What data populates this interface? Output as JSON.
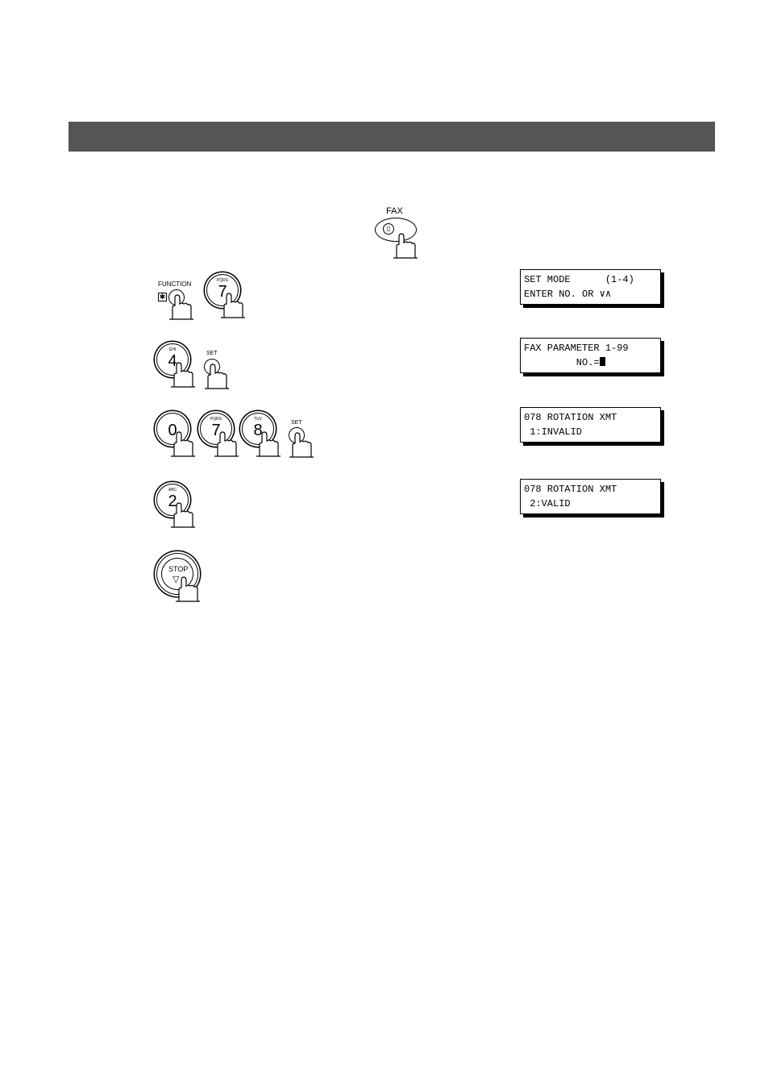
{
  "header": {
    "color": "#555555"
  },
  "fax_button": {
    "label": "FAX",
    "icon": "fax-document-icon"
  },
  "steps": [
    {
      "keys": [
        {
          "label": "FUNCTION",
          "symbol": "✱"
        },
        {
          "number": "7",
          "letters": "PQRS"
        }
      ],
      "display": [
        "SET MODE      (1-4)",
        "ENTER NO. OR ∨∧"
      ]
    },
    {
      "keys": [
        {
          "number": "4",
          "letters": "GHI"
        },
        {
          "label": "SET"
        }
      ],
      "display": [
        "FAX PARAMETER 1-99",
        "         NO.="
      ]
    },
    {
      "keys": [
        {
          "number": "0",
          "letters": ""
        },
        {
          "number": "7",
          "letters": "PQRS"
        },
        {
          "number": "8",
          "letters": "TUV"
        },
        {
          "label": "SET"
        }
      ],
      "display": [
        "078 ROTATION XMT",
        " 1:INVALID"
      ]
    },
    {
      "keys": [
        {
          "number": "2",
          "letters": "ABC"
        }
      ],
      "display": [
        "078 ROTATION XMT",
        " 2:VALID"
      ]
    },
    {
      "keys": [
        {
          "label": "STOP",
          "icon": "stop-triangle-icon"
        }
      ]
    }
  ]
}
